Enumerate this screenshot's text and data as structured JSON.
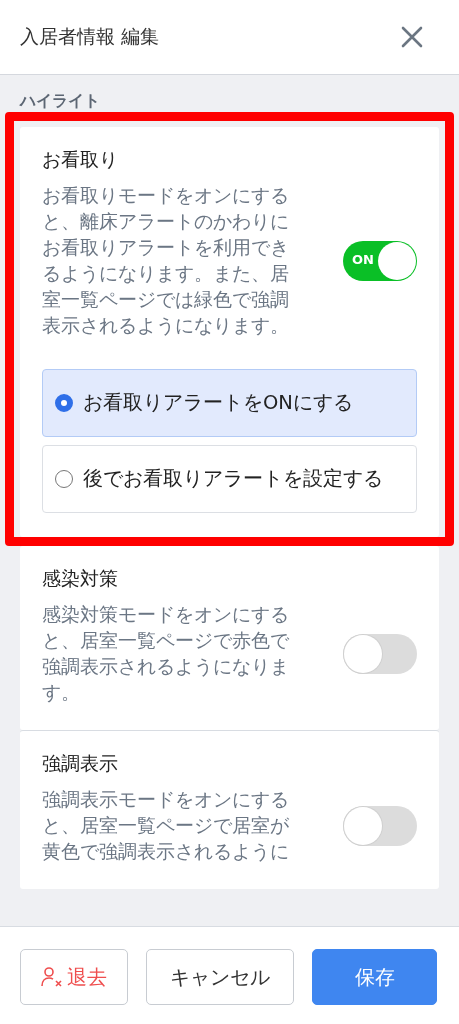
{
  "header": {
    "title": "入居者情報 編集"
  },
  "section_label": "ハイライト",
  "items": [
    {
      "title": "お看取り",
      "description": "お看取りモードをオンにすると、離床アラートのかわりにお看取りアラートを利用できるようになります。また、居室一覧ページでは緑色で強調表示されるようになります。",
      "on": true,
      "toggle_label": "ON",
      "highlighted": true,
      "options": [
        {
          "label": "お看取りアラートをONにする",
          "selected": true
        },
        {
          "label": "後でお看取りアラートを設定する",
          "selected": false
        }
      ]
    },
    {
      "title": "感染対策",
      "description": "感染対策モードをオンにすると、居室一覧ページで赤色で強調表示されるようになります。",
      "on": false,
      "highlighted": false
    },
    {
      "title": "強調表示",
      "description": "強調表示モードをオンにすると、居室一覧ページで居室が黄色で強調表示されるように",
      "on": false,
      "highlighted": false
    }
  ],
  "footer": {
    "buttons": [
      {
        "label": "退去",
        "kind": "danger"
      },
      {
        "label": "キャンセル",
        "kind": "default"
      },
      {
        "label": "保存",
        "kind": "primary"
      }
    ]
  }
}
